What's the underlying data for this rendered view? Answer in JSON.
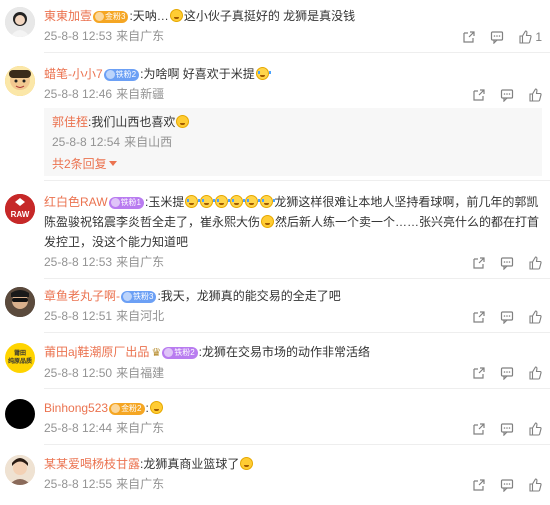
{
  "comments": [
    {
      "user": "東東加壹",
      "badge": "金粉3",
      "text": ":天呐…",
      "text2": "这小伙子真挺好的 龙狮是真没钱",
      "time": "25-8-8 12:53",
      "location": "来自广东",
      "likes": "1"
    },
    {
      "user": "蜡笔-小小7",
      "badge": "铁粉2",
      "text": ":为啥啊 好喜欢于米提",
      "time": "25-8-8 12:46",
      "location": "来自新疆",
      "reply": {
        "user": "郭佳桎",
        "text": ":我们山西也喜欢",
        "time": "25-8-8 12:54",
        "location": "来自山西"
      },
      "more": "共2条回复"
    },
    {
      "user": "红白色RAW",
      "badge": "铁粉1",
      "text_a": ":玉米提",
      "text_b": "龙狮这样很难让本地人坚持看球啊，前几年的郭凯陈盈骏祝铭震李炎哲全走了，崔永熙大伤",
      "text_c": "然后新人练一个卖一个……张兴亮什么的都在打首发控卫，没这个能力知道吧",
      "time": "25-8-8 12:53",
      "location": "来自广东",
      "avatar_label": "RAW"
    },
    {
      "user": "章鱼老丸子啊-",
      "badge": "铁粉3",
      "text": ":我天，龙狮真的能交易的全走了吧",
      "time": "25-8-8 12:51",
      "location": "来自河北"
    },
    {
      "user": "莆田aj鞋潮原厂出品",
      "badge": "铁粉2",
      "text": ":龙狮在交易市场的动作非常活络",
      "time": "25-8-8 12:50",
      "location": "来自福建",
      "avatar_label": "莆田\n纯原品质"
    },
    {
      "user": "Binhong523",
      "badge": "金粉2",
      "text": ":",
      "time": "25-8-8 12:44",
      "location": "来自广东"
    },
    {
      "user": "某某爱喝杨枝甘露",
      "text": ":龙狮真商业篮球了",
      "time": "25-8-8 12:55",
      "location": "来自广东"
    }
  ],
  "colors": {
    "accent": "#eb7350",
    "meta": "#939393",
    "reply_bg": "#f7f7f7"
  }
}
